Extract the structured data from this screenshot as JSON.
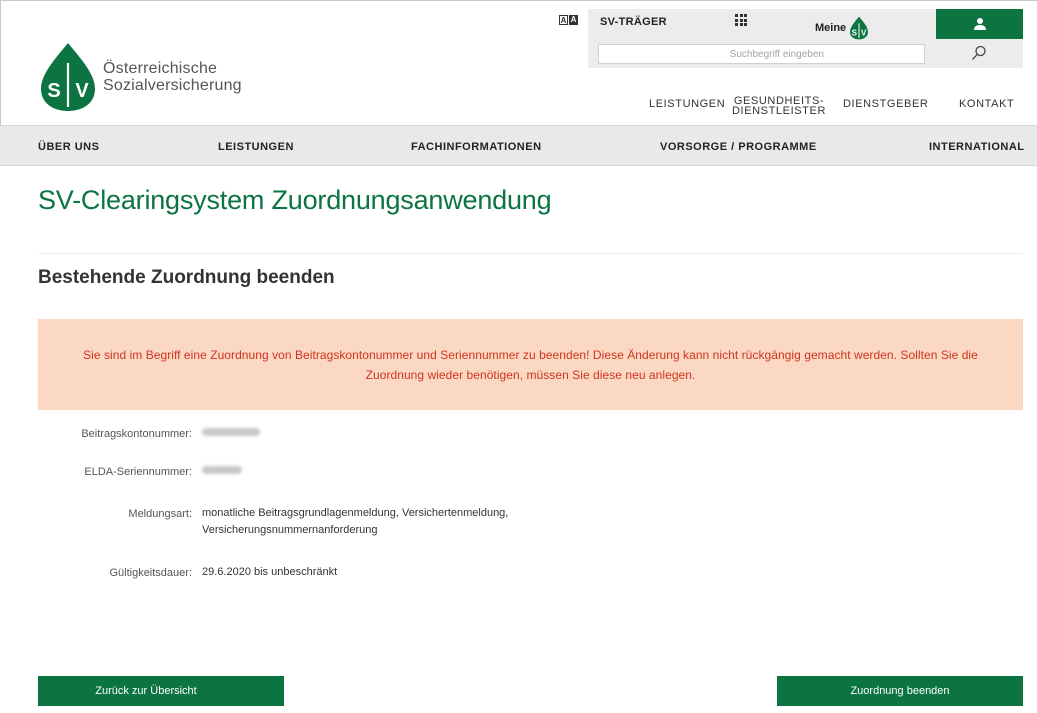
{
  "header": {
    "logo_line1": "Österreichische",
    "logo_line2": "Sozialversicherung",
    "logo_mark": "SV",
    "sv_traeger": "SV-TRÄGER",
    "meine_label": "Meine",
    "search_placeholder": "Suchbegriff eingeben",
    "topnav": [
      "LEISTUNGEN",
      "GESUNDHEITS-",
      "DIENSTLEISTER",
      "DIENSTGEBER",
      "KONTAKT"
    ]
  },
  "mainnav": [
    "ÜBER UNS",
    "LEISTUNGEN",
    "FACHINFORMATIONEN",
    "VORSORGE / PROGRAMME",
    "INTERNATIONAL"
  ],
  "page": {
    "title": "SV-Clearingsystem Zuordnungsanwendung",
    "section_title": "Bestehende Zuordnung beenden",
    "warning_line1": "Sie sind im Begriff eine Zuordnung von Beitragskontonummer und Seriennummer zu beenden! Diese Änderung kann nicht rückgängig gemacht werden. Sollten Sie die",
    "warning_line2": "Zuordnung wieder benötigen, müssen Sie diese neu anlegen."
  },
  "fields": {
    "beitragskontonummer_label": "Beitragskontonummer:",
    "elda_label": "ELDA-Seriennummer:",
    "meldungsart_label": "Meldungsart:",
    "meldungsart_line1": "monatliche Beitragsgrundlagenmeldung, Versichertenmeldung,",
    "meldungsart_line2": "Versicherungsnummernanforderung",
    "gueltigkeit_label": "Gültigkeitsdauer:",
    "gueltigkeit_value": "29.6.2020 bis unbeschränkt"
  },
  "buttons": {
    "back": "Zurück zur Übersicht",
    "end": "Zuordnung beenden"
  },
  "icons": {
    "contrast": "contrast-toggle-icon",
    "apps": "apps-grid-icon",
    "user": "user-icon",
    "search": "search-icon"
  },
  "colors": {
    "brand_green": "#0b7440",
    "warning_bg": "#fbd8c4",
    "warning_text": "#d0341e",
    "nav_bg": "#e9e9e9"
  }
}
